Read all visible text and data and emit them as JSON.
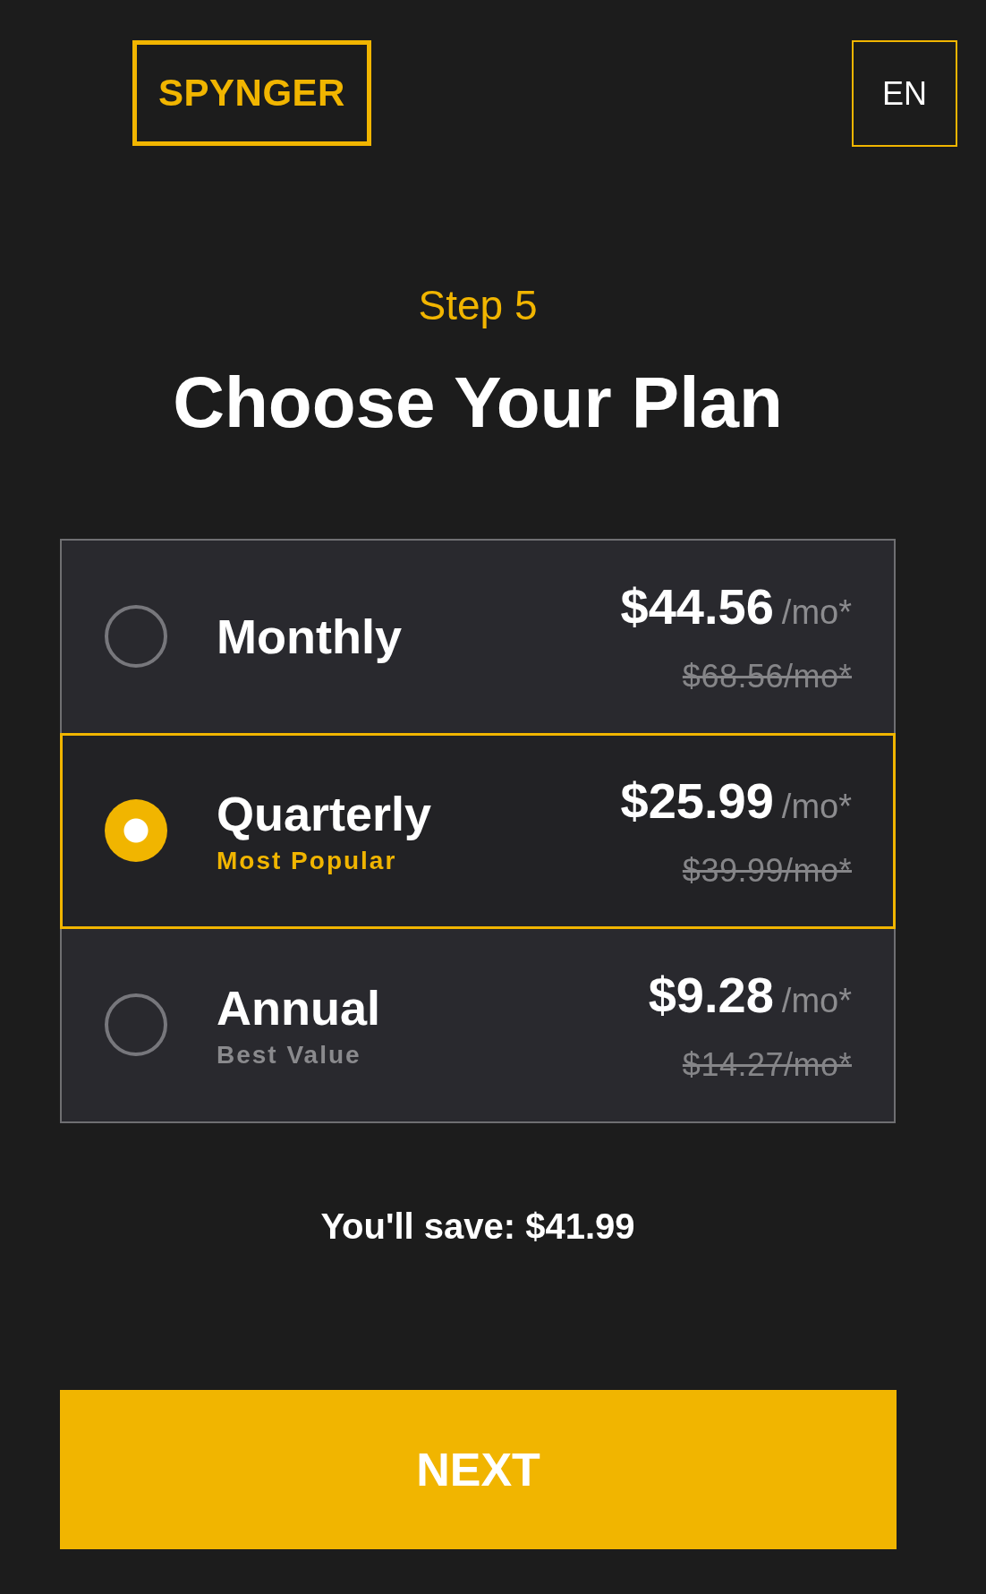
{
  "header": {
    "logo": "SPYNGER",
    "language": "EN"
  },
  "step": "Step 5",
  "title": "Choose Your Plan",
  "plans": [
    {
      "name": "Monthly",
      "price": "$44.56",
      "unit": "/mo*",
      "old_price": "$68.56/mo*",
      "selected": false
    },
    {
      "name": "Quarterly",
      "tag": "Most Popular",
      "price": "$25.99",
      "unit": "/mo*",
      "old_price": "$39.99/mo*",
      "selected": true
    },
    {
      "name": "Annual",
      "tag": "Best Value",
      "price": "$9.28",
      "unit": "/mo*",
      "old_price": "$14.27/mo*",
      "selected": false
    }
  ],
  "savings": "You'll save: $41.99",
  "next_button": "NEXT"
}
